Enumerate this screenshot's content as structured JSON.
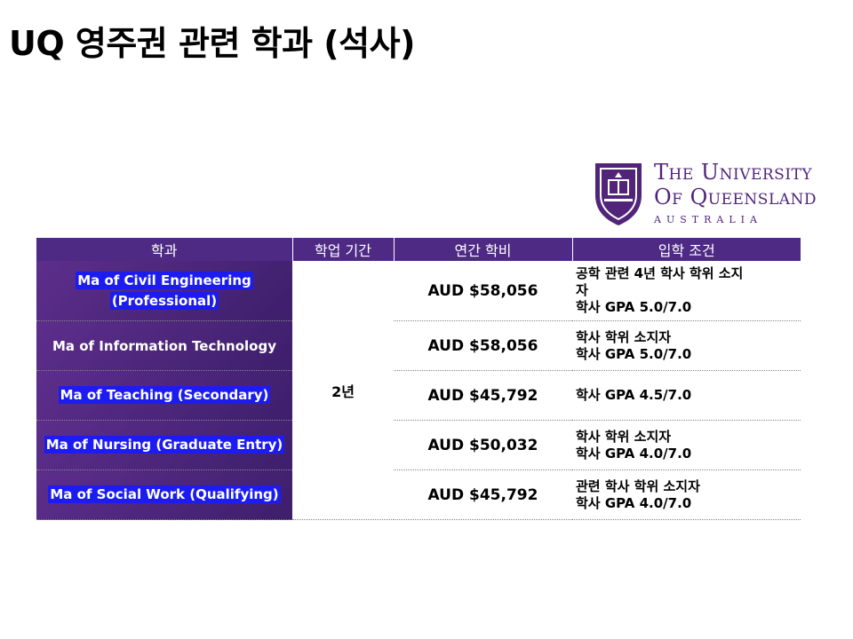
{
  "title": "UQ 영주권 관련 학과 (석사)",
  "logo": {
    "line1": "The University",
    "line2": "Of Queensland",
    "line3": "AUSTRALIA"
  },
  "table": {
    "headers": [
      "학과",
      "학업 기간",
      "연간 학비",
      "입학 조건"
    ],
    "duration": "2년",
    "rows": [
      {
        "program": [
          "Ma of Civil Engineering",
          "(Professional)"
        ],
        "fee": "AUD $58,056",
        "req": [
          "공학 관련 4년 학사 학위 소지",
          "자",
          "학사 GPA 5.0/7.0"
        ]
      },
      {
        "program": [
          "Ma of Information Technology"
        ],
        "fee": "AUD $58,056",
        "req": [
          "학사 학위 소지자",
          "학사 GPA 5.0/7.0"
        ]
      },
      {
        "program": [
          "Ma of Teaching (Secondary)"
        ],
        "fee": "AUD $45,792",
        "req": [
          "학사 GPA 4.5/7.0"
        ]
      },
      {
        "program": [
          "Ma of Nursing (Graduate Entry)"
        ],
        "fee": "AUD $50,032",
        "req": [
          "학사 학위 소지자",
          "학사 GPA 4.0/7.0"
        ]
      },
      {
        "program": [
          "Ma of Social Work (Qualifying)"
        ],
        "fee": "AUD $45,792",
        "req": [
          "관련 학사 학위 소지자",
          "학사 GPA 4.0/7.0"
        ]
      }
    ]
  },
  "colors": {
    "header_bg": "#4e2a85",
    "highlight": "#1c1cf0",
    "brand": "#51247a"
  }
}
